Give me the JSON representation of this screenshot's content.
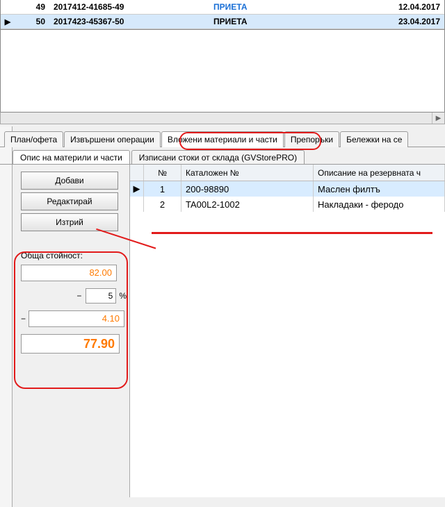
{
  "top_grid": {
    "rows": [
      {
        "indicator": "",
        "n": "49",
        "doc": "2017412-41685-49",
        "status": "ПРИЕТА",
        "status_link": true,
        "date": "12.04.2017",
        "selected": false
      },
      {
        "indicator": "▶",
        "n": "50",
        "doc": "2017423-45367-50",
        "status": "ПРИЕТА",
        "status_link": false,
        "date": "23.04.2017",
        "selected": true
      }
    ]
  },
  "main_tabs": [
    {
      "label": "План/офета"
    },
    {
      "label": "Извършени операции"
    },
    {
      "label": "Вложени материали и части"
    },
    {
      "label": "Препоръки"
    },
    {
      "label": "Бележки на се"
    }
  ],
  "sub_tabs": [
    {
      "label": "Опис на материли и части"
    },
    {
      "label": "Изписани стоки от склада (GVStorePRO)"
    }
  ],
  "buttons": {
    "add": "Добави",
    "edit": "Редактирай",
    "delete": "Изтрий"
  },
  "totals": {
    "label": "Обща стойност:",
    "subtotal": "82.00",
    "discount_pct": "5",
    "pct_sign": "%",
    "discount_amt": "4.10",
    "total": "77.90",
    "dash": "−",
    "dash2": "−"
  },
  "parts_header": {
    "n": "№",
    "cat": "Каталожен №",
    "desc": "Описание на резервната ч"
  },
  "parts_rows": [
    {
      "indicator": "▶",
      "n": "1",
      "cat": "200-98890",
      "desc": "Маслен филтъ",
      "selected": true
    },
    {
      "indicator": "",
      "n": "2",
      "cat": "TA00L2-1002",
      "desc": "Накладаки - феродо",
      "selected": false
    }
  ],
  "scroll_arrow": "▶"
}
